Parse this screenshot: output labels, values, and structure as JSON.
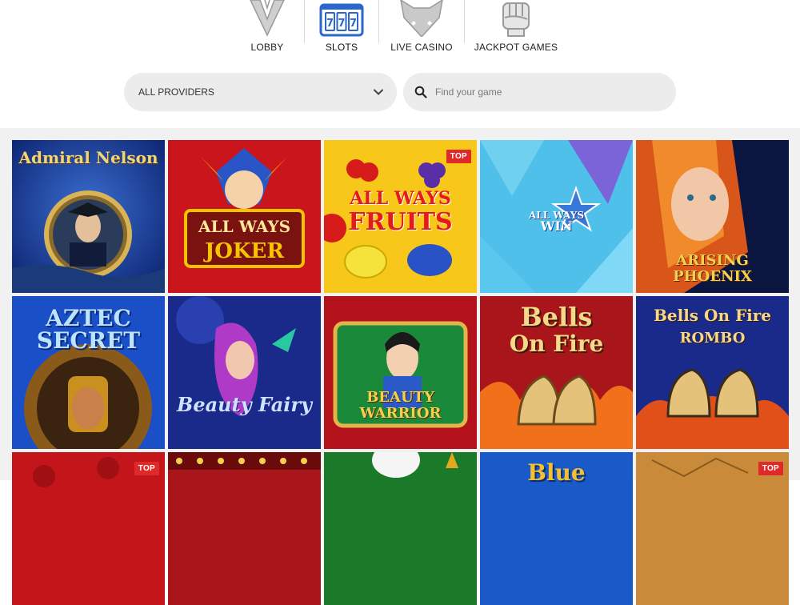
{
  "nav": {
    "items": [
      {
        "label": "LOBBY",
        "icon": "lobby-shield-icon"
      },
      {
        "label": "SLOTS",
        "icon": "slot-machine-icon"
      },
      {
        "label": "LIVE CASINO",
        "icon": "fox-icon"
      },
      {
        "label": "JACKPOT GAMES",
        "icon": "fist-icon"
      }
    ],
    "active": "SLOTS",
    "accent_color": "#2a67c9"
  },
  "filters": {
    "provider": {
      "value": "ALL PROVIDERS"
    },
    "search": {
      "placeholder": "Find your game"
    }
  },
  "games": [
    {
      "title_line1": "Admiral",
      "title_line2": "Nelson",
      "badge": ""
    },
    {
      "title_line1": "ALL WAYS",
      "title_line2": "JOKER",
      "badge": ""
    },
    {
      "title_line1": "ALL WAYS",
      "title_line2": "FRUITS",
      "badge": "TOP"
    },
    {
      "title_line1": "ALL WAYS",
      "title_line2": "WIN",
      "badge": ""
    },
    {
      "title_line1": "ARISING",
      "title_line2": "PHOENIX",
      "badge": ""
    },
    {
      "title_line1": "AZTEC",
      "title_line2": "SECRET",
      "badge": ""
    },
    {
      "title_line1": "Beauty Fairy",
      "title_line2": "",
      "badge": ""
    },
    {
      "title_line1": "BEAUTY",
      "title_line2": "WARRIOR",
      "badge": ""
    },
    {
      "title_line1": "Bells",
      "title_line2": "On Fire",
      "badge": ""
    },
    {
      "title_line1": "Bells On Fire",
      "title_line2": "ROMBO",
      "badge": ""
    },
    {
      "title_line1": "",
      "title_line2": "",
      "badge": "TOP"
    },
    {
      "title_line1": "",
      "title_line2": "",
      "badge": ""
    },
    {
      "title_line1": "",
      "title_line2": "",
      "badge": ""
    },
    {
      "title_line1": "Blue",
      "title_line2": "",
      "badge": ""
    },
    {
      "title_line1": "",
      "title_line2": "",
      "badge": "TOP"
    }
  ]
}
